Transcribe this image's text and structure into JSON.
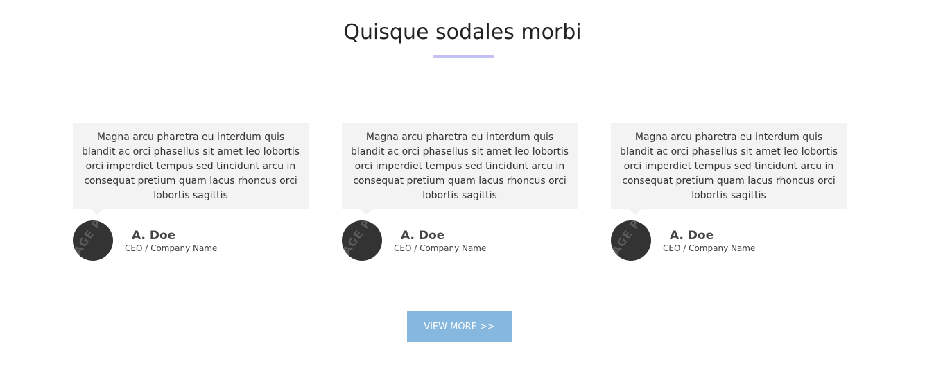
{
  "section": {
    "title": "Quisque sodales morbi",
    "accent_color": "#c3c0f2"
  },
  "testimonials": [
    {
      "quote": "Magna arcu pharetra eu interdum quis blandit ac orci phasellus sit amet leo lobortis orci imperdiet tempus sed tincidunt arcu in consequat pretium quam lacus rhoncus orci lobortis sagittis",
      "name": "A. Doe",
      "role": "CEO / Company Name",
      "avatar_watermark": "AGE P"
    },
    {
      "quote": "Magna arcu pharetra eu interdum quis blandit ac orci phasellus sit amet leo lobortis orci imperdiet tempus sed tincidunt arcu in consequat pretium quam lacus rhoncus orci lobortis sagittis",
      "name": "A. Doe",
      "role": "CEO / Company Name",
      "avatar_watermark": "AGE P"
    },
    {
      "quote": "Magna arcu pharetra eu interdum quis blandit ac orci phasellus sit amet leo lobortis orci imperdiet tempus sed tincidunt arcu in consequat pretium quam lacus rhoncus orci lobortis sagittis",
      "name": "A. Doe",
      "role": "CEO / Company Name",
      "avatar_watermark": "AGE P"
    }
  ],
  "cta": {
    "label": "VIEW MORE >>",
    "color": "#86b7de"
  }
}
